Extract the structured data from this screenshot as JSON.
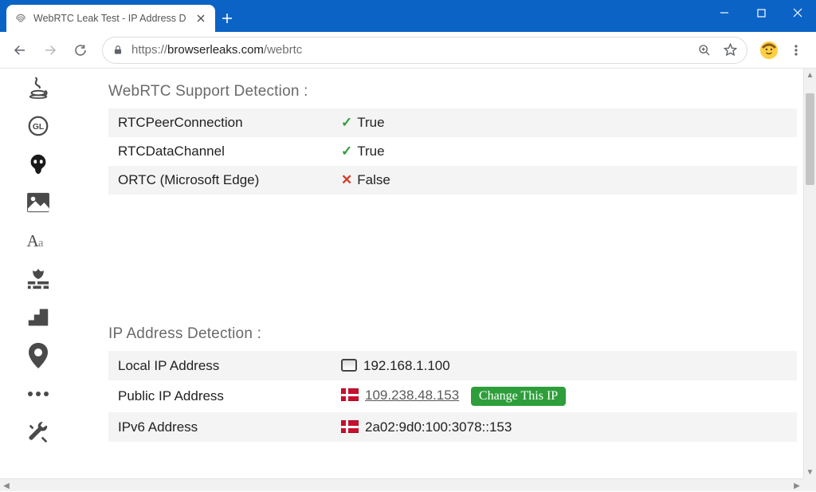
{
  "window": {
    "tab_title": "WebRTC Leak Test - IP Address D"
  },
  "toolbar": {
    "url_proto": "https://",
    "url_host": "browserleaks.com",
    "url_path": "/webrtc"
  },
  "sections": {
    "support_title": "WebRTC Support Detection :",
    "ip_title": "IP Address Detection :"
  },
  "support_rows": [
    {
      "label": "RTCPeerConnection",
      "value": "True",
      "ok": true
    },
    {
      "label": "RTCDataChannel",
      "value": "True",
      "ok": true
    },
    {
      "label": "ORTC (Microsoft Edge)",
      "value": "False",
      "ok": false
    }
  ],
  "ip_rows": {
    "local_label": "Local IP Address",
    "local_value": "192.168.1.100",
    "public_label": "Public IP Address",
    "public_value": "109.238.48.153",
    "change_btn": "Change This IP",
    "ipv6_label": "IPv6 Address",
    "ipv6_value": "2a02:9d0:100:3078::153"
  }
}
